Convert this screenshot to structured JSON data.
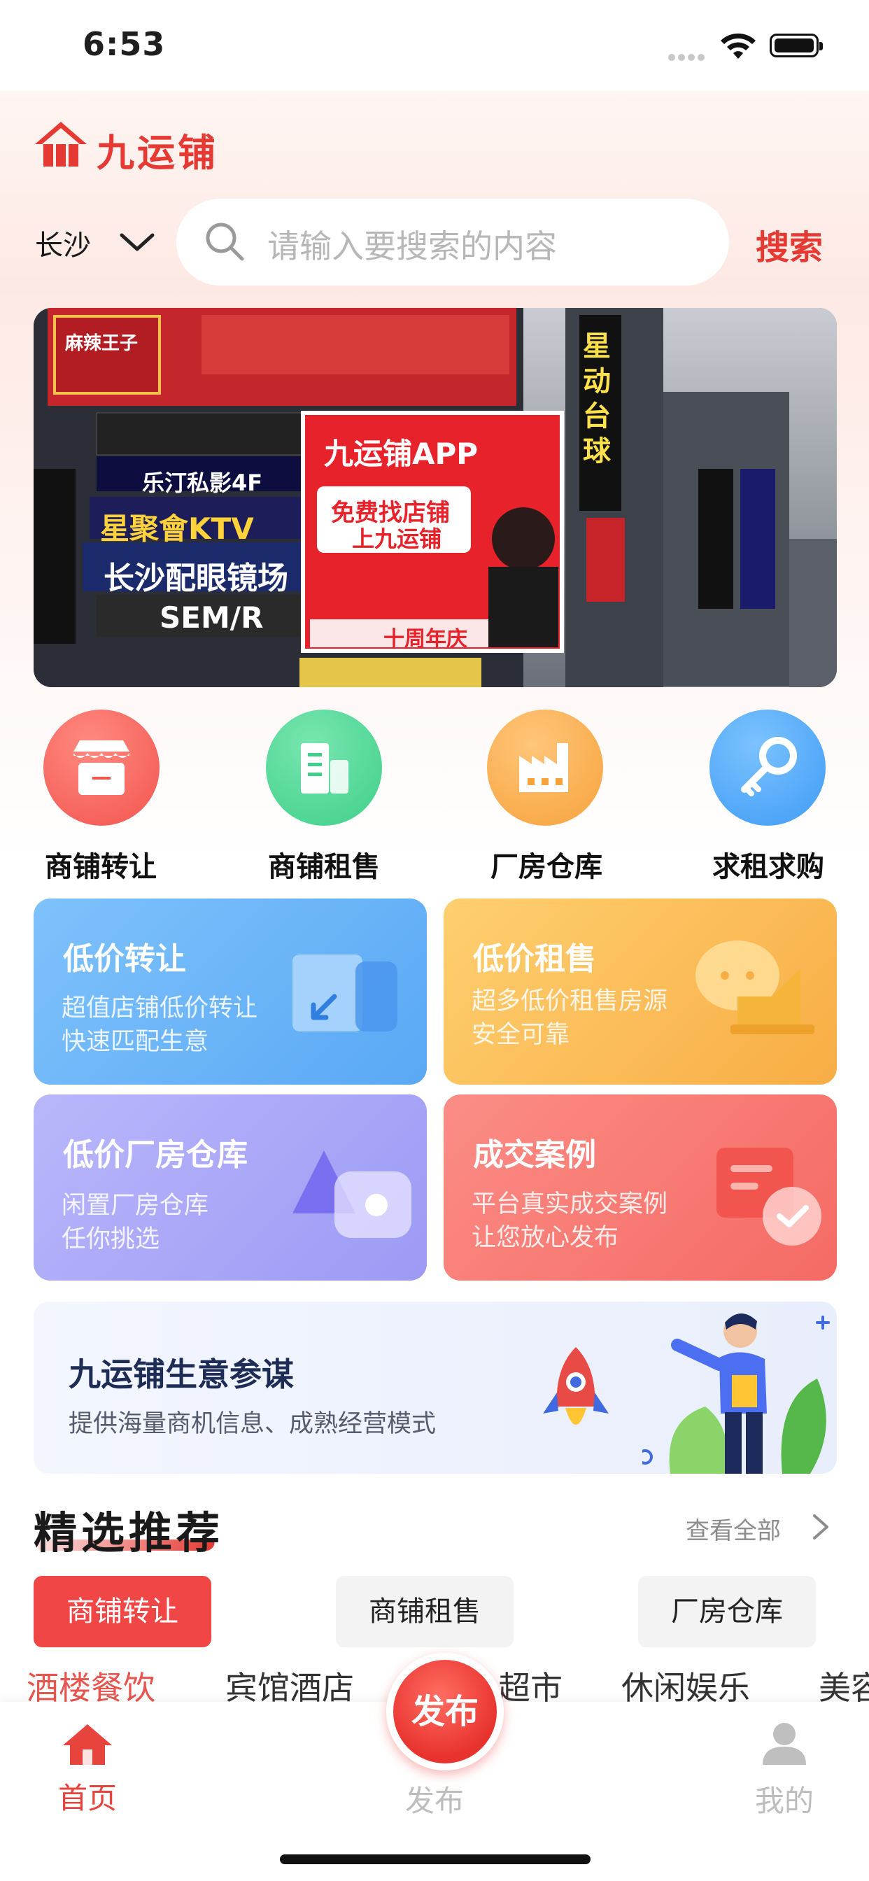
{
  "status_bar": {
    "time": "6:53"
  },
  "brand": {
    "name": "九运铺",
    "accent": "#e53a33"
  },
  "search": {
    "city": "长沙",
    "placeholder": "请输入要搜索的内容",
    "button": "搜索"
  },
  "banner": {
    "billboard_brand": "九运铺APP",
    "billboard_headline_1": "免费找店铺",
    "billboard_headline_2": "上九运铺",
    "billboard_footer": "十周年庆",
    "signs": [
      "麻辣王子",
      "乐汀私影4F",
      "星聚會KTV",
      "长沙配眼镜场",
      "SEM/R",
      "星动台球"
    ]
  },
  "categories": [
    {
      "label": "商铺转让",
      "icon": "shop-icon",
      "color": "#f2554e"
    },
    {
      "label": "商铺租售",
      "icon": "building-icon",
      "color": "#3fcf8a"
    },
    {
      "label": "厂房仓库",
      "icon": "factory-icon",
      "color": "#f7a23b"
    },
    {
      "label": "求租求购",
      "icon": "key-icon",
      "color": "#3e9cf5"
    }
  ],
  "feature_cards": [
    {
      "title": "低价转让",
      "lines": [
        "超值店铺低价转让",
        "快速匹配生意"
      ],
      "color": "#6fb6f8"
    },
    {
      "title": "低价租售",
      "lines": [
        "超多低价租售房源",
        "安全可靠"
      ],
      "color": "#fbbd5a"
    },
    {
      "title": "低价厂房仓库",
      "lines": [
        "闲置厂房仓库",
        "任你挑选"
      ],
      "color": "#a7a5f7"
    },
    {
      "title": "成交案例",
      "lines": [
        "平台真实成交案例",
        "让您放心发布"
      ],
      "color": "#f87a74"
    }
  ],
  "advisor": {
    "title": "九运铺生意参谋",
    "subtitle": "提供海量商机信息、成熟经营模式"
  },
  "recommended": {
    "title": "精选推荐",
    "view_all": "查看全部",
    "pills": [
      "商铺转让",
      "商铺租售",
      "厂房仓库"
    ],
    "active_pill": "商铺转让",
    "sub_tabs": [
      "酒楼餐饮",
      "宾馆酒店",
      "超市",
      "休闲娱乐",
      "美容"
    ],
    "active_sub_tab": "酒楼餐饮"
  },
  "tabbar": {
    "home": "首页",
    "publish": "发布",
    "publish_button": "发布",
    "mine": "我的"
  }
}
